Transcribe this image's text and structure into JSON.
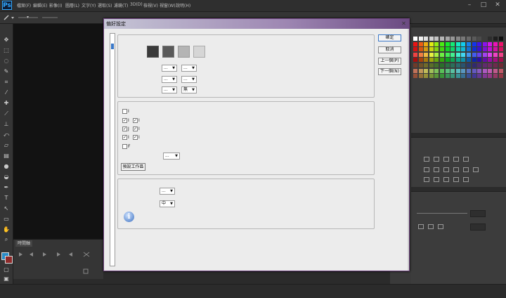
{
  "app": {
    "logo": "Ps"
  },
  "menubar": {
    "items": [
      "檔案(F)",
      "編輯(E)",
      "影像(I)",
      "圖層(L)",
      "文字(Y)",
      "選取(S)",
      "濾鏡(T)",
      "3D(D)",
      "檢視(V)",
      "視窗(W)",
      "說明(H)"
    ]
  },
  "window_controls": {
    "minimize": "–",
    "maximize": "□",
    "close": "✕"
  },
  "timeline": {
    "tab_label": "時間軸"
  },
  "dialog": {
    "title": "偏好設定",
    "close_symbol": "✕",
    "buttons": {
      "ok": "確定",
      "cancel": "取消",
      "prev": "上一個(P)",
      "next": "下一個(N)"
    },
    "appearance": {
      "themes": [
        "#3a3a3a",
        "#595959",
        "#b4b4b4",
        "#d6d6d6"
      ],
      "dropdowns": [
        {
          "value": "..."
        },
        {
          "value": "..."
        },
        {
          "value": "..."
        },
        {
          "value": "..."
        },
        {
          "value": "..."
        },
        {
          "value": "無"
        }
      ]
    },
    "options": {
      "checkboxes": [
        {
          "checked": false,
          "label": "I"
        },
        {
          "checked": true,
          "label": "I"
        },
        {
          "checked": true,
          "label": "I"
        },
        {
          "checked": true,
          "label": "J"
        },
        {
          "checked": true,
          "label": "I"
        },
        {
          "checked": true,
          "label": "I"
        },
        {
          "checked": true,
          "label": "I"
        },
        {
          "checked": false,
          "label": "F"
        }
      ],
      "dropdown": {
        "value": "..."
      },
      "reset_workspace_button": "預設工作區"
    },
    "text": {
      "dropdowns": [
        {
          "value": "..."
        },
        {
          "value": "中"
        }
      ],
      "info_symbol": "i"
    }
  },
  "arrow_symbol": "▼"
}
